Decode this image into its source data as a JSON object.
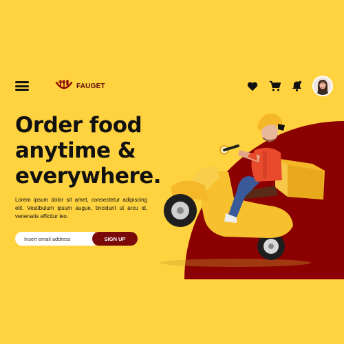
{
  "brand": {
    "name": "FAUGET"
  },
  "icons": {
    "menu": "hamburger-menu-icon",
    "logo": "fork-spoon-logo-icon",
    "favorites": "heart-icon",
    "cart": "cart-icon",
    "notifications": "bell-icon",
    "profile": "user-avatar"
  },
  "hero": {
    "headline_line1": "Order food",
    "headline_line2": "anytime &",
    "headline_line3": "everywhere.",
    "body": "Lorem ipsum dolor sit amet, consectetur adipiscing elit. Vestibulum ipsum augue, tincidunt ut arcu id, venenatis efficitur leo."
  },
  "signup": {
    "placeholder": "Insert email address",
    "button_label": "SIGN UP"
  },
  "colors": {
    "background": "#FFD23F",
    "accent_red": "#8B0000",
    "button": "#7A0A0A"
  }
}
